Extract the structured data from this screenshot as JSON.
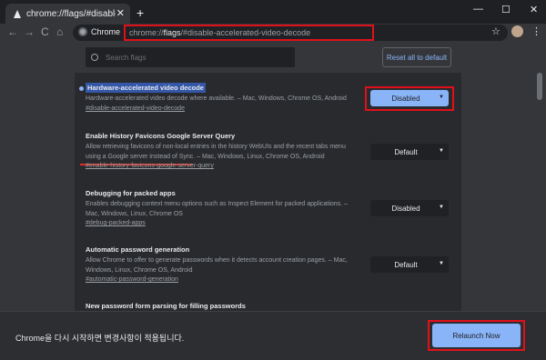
{
  "tab": {
    "title": "chrome://flags/#disable-accelerat",
    "close_label": "✕",
    "new_tab": "+"
  },
  "window_controls": {
    "minimize": "—",
    "maximize": "☐",
    "close": "✕"
  },
  "nav": {
    "back": "←",
    "forward": "→",
    "reload": "C",
    "home": "⌂"
  },
  "omnibox": {
    "site_label": "Chrome",
    "url_scheme": "chrome://",
    "url_host": "flags",
    "url_rest": "/#disable-accelerated-video-decode"
  },
  "toolbar": {
    "star": "☆",
    "menu": "⋮"
  },
  "search": {
    "placeholder": "Search flags"
  },
  "reset_button": "Reset all to default",
  "flags": [
    {
      "title": "Hardware-accelerated video decode",
      "desc": "Hardware-accelerated video decode where available. – Mac, Windows, Chrome OS, Android",
      "anchor": "#disable-accelerated-video-decode",
      "value": "Disabled"
    },
    {
      "title": "Enable History Favicons Google Server Query",
      "desc": "Allow retrieving favicons of non-local entries in the history WebUIs and the recent tabs menu using a Google server instead of Sync. – Mac, Windows, Linux, Chrome OS, Android",
      "anchor": "#enable-history-favicons-google-server-query",
      "value": "Default"
    },
    {
      "title": "Debugging for packed apps",
      "desc": "Enables debugging context menu options such as Inspect Element for packed applications. – Mac, Windows, Linux, Chrome OS",
      "anchor": "#debug-packed-apps",
      "value": "Disabled"
    },
    {
      "title": "Automatic password generation",
      "desc": "Allow Chrome to offer to generate passwords when it detects account creation pages. – Mac, Windows, Linux, Chrome OS, Android",
      "anchor": "#automatic-password-generation",
      "value": "Default"
    },
    {
      "title": "New password form parsing for filling passwords"
    }
  ],
  "caret": "▼",
  "footer": {
    "message": "Chrome을 다시 시작하면 변경사항이 적용됩니다.",
    "relaunch_label": "Relaunch Now"
  },
  "colors": {
    "accent": "#8ab4f8",
    "highlight_frame": "#e0101a",
    "background": "#202124"
  }
}
